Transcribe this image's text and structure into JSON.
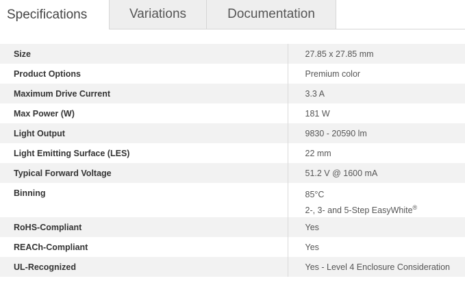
{
  "tabs": [
    {
      "label": "Specifications",
      "active": true
    },
    {
      "label": "Variations",
      "active": false
    },
    {
      "label": "Documentation",
      "active": false
    }
  ],
  "specs": [
    {
      "label": "Size",
      "value": "27.85 x 27.85 mm"
    },
    {
      "label": "Product Options",
      "value": "Premium color"
    },
    {
      "label": "Maximum Drive Current",
      "value": "3.3 A"
    },
    {
      "label": "Max Power (W)",
      "value": "181 W"
    },
    {
      "label": "Light Output",
      "value": "9830 - 20590 lm"
    },
    {
      "label": "Light Emitting Surface (LES)",
      "value": "22 mm"
    },
    {
      "label": "Typical Forward Voltage",
      "value": "51.2 V @ 1600 mA"
    },
    {
      "label": "Binning",
      "value_line1": "85°C",
      "value_line2": "2-, 3- and 5-Step EasyWhite",
      "value_sup": "®"
    },
    {
      "label": "RoHS-Compliant",
      "value": "Yes"
    },
    {
      "label": "REACh-Compliant",
      "value": "Yes"
    },
    {
      "label": "UL-Recognized",
      "value": "Yes - Level 4 Enclosure Consideration"
    }
  ],
  "colors": {
    "row_shade": "#f2f2f2",
    "tab_inactive": "#eeeeee",
    "border": "#d6d6d6"
  }
}
